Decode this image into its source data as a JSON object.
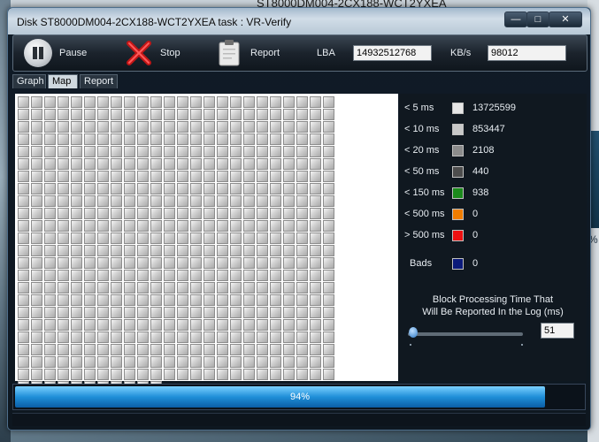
{
  "background": {
    "title": "ST8000DM004-2CX188-WCT2YXEA",
    "side_percent": "%"
  },
  "window": {
    "title": "Disk ST8000DM004-2CX188-WCT2YXEA   task : VR-Verify",
    "controls": {
      "minimize": "—",
      "maximize": "□",
      "close": "✕"
    }
  },
  "toolbar": {
    "pause": "Pause",
    "stop": "Stop",
    "report": "Report",
    "lba_label": "LBA",
    "lba_value": "14932512768",
    "speed_label": "KB/s",
    "speed_value": "98012"
  },
  "tabs": [
    "Graph",
    "Map",
    "Report"
  ],
  "active_tab": "Map",
  "map": {
    "rows": 24,
    "cols": 24,
    "last_row_cells": 11
  },
  "legend": [
    {
      "label": "< 5 ms",
      "color": "#e6e6e6",
      "value": "13725599"
    },
    {
      "label": "< 10 ms",
      "color": "#c8c8c8",
      "value": "853447"
    },
    {
      "label": "< 20 ms",
      "color": "#8c8c8c",
      "value": "2108"
    },
    {
      "label": "< 50 ms",
      "color": "#4d4d4d",
      "value": "440"
    },
    {
      "label": "< 150 ms",
      "color": "#1c8a1c",
      "value": "938"
    },
    {
      "label": "< 500 ms",
      "color": "#f07d00",
      "value": "0"
    },
    {
      "label": "> 500 ms",
      "color": "#ee1111",
      "value": "0"
    },
    {
      "label": "Bads",
      "color": "#0b1a7a",
      "value": "0"
    }
  ],
  "threshold": {
    "note_line1": "Block Processing Time That",
    "note_line2": "Will Be Reported In the Log (ms)",
    "value": "51"
  },
  "progress": {
    "percent": 94,
    "label": "94%"
  }
}
